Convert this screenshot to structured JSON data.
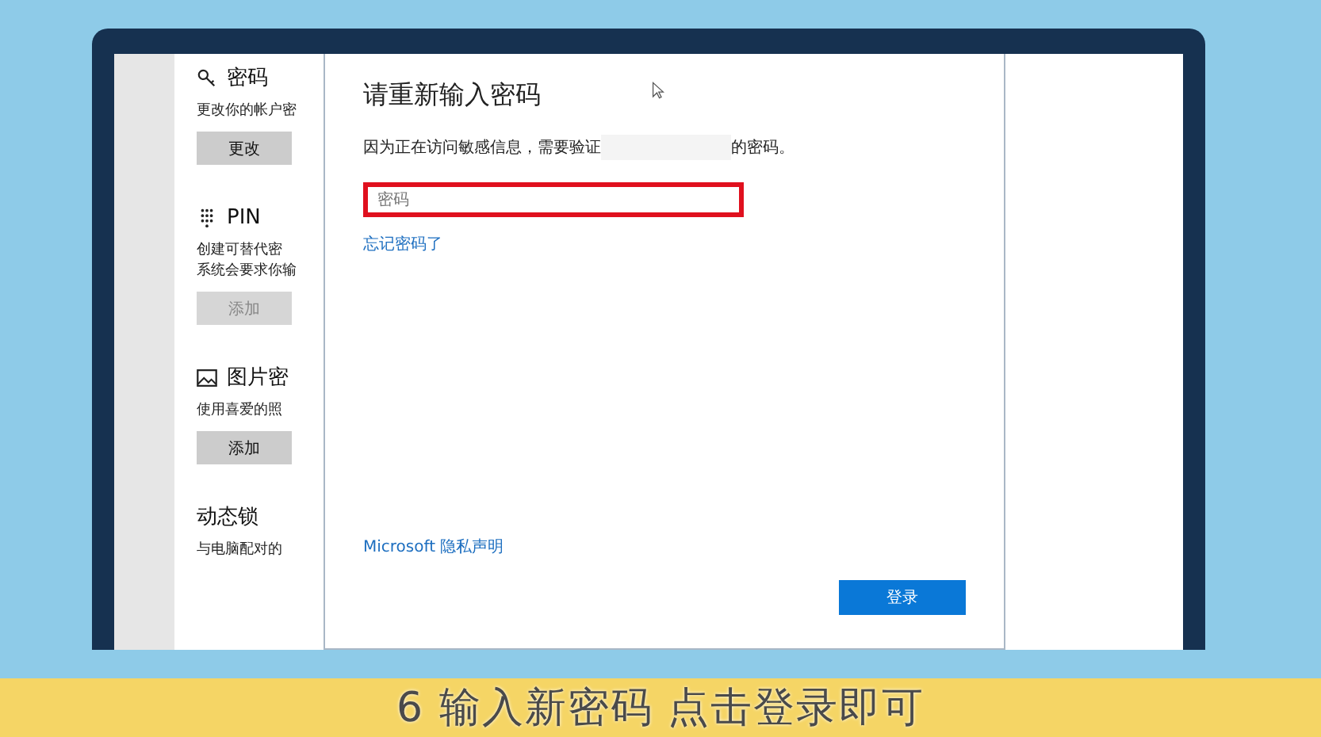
{
  "settings_panel": {
    "sections": [
      {
        "kind": "password",
        "title": "密码",
        "description": [
          "更改你的帐户密"
        ],
        "button": {
          "label": "更改",
          "disabled": false
        }
      },
      {
        "kind": "pin",
        "title": "PIN",
        "description": [
          "创建可替代密",
          "系统会要求你输"
        ],
        "button": {
          "label": "添加",
          "disabled": true
        }
      },
      {
        "kind": "picture",
        "title": "图片密",
        "description": [
          "使用喜爱的照"
        ],
        "button": {
          "label": "添加",
          "disabled": false
        }
      },
      {
        "kind": "lock",
        "title": "动态锁",
        "description": [
          "与电脑配对的"
        ]
      }
    ]
  },
  "dialog": {
    "title": "请重新输入密码",
    "description": "因为正在访问敏感信息，需要验证",
    "description_end": "的密码。",
    "password_field": {
      "placeholder": "密码",
      "highlighted": true
    },
    "forgot_link": "忘记密码了",
    "privacy_link": "Microsoft 隐私声明",
    "sign_in_button": "登录"
  },
  "caption": "6 输入新密码 点击登录即可"
}
